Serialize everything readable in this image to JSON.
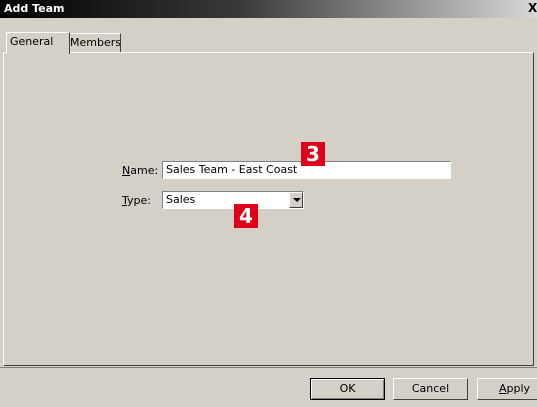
{
  "window": {
    "title": "Add Team",
    "close_label": "X"
  },
  "tabs": [
    {
      "label": "General",
      "active": true
    },
    {
      "label": "Members",
      "active": false
    }
  ],
  "form": {
    "name_label_mnemonic": "N",
    "name_label_rest": "ame:",
    "name_value": "Sales Team - East Coast",
    "type_label_mnemonic": "T",
    "type_label_rest": "ype:",
    "type_value": "Sales"
  },
  "callouts": {
    "name": "3",
    "type": "4"
  },
  "buttons": {
    "ok": "OK",
    "cancel": "Cancel",
    "apply_mnemonic": "A",
    "apply_rest": "pply"
  },
  "colors": {
    "callout": "#e0001a",
    "dialog_bg": "#d4d0c8"
  }
}
